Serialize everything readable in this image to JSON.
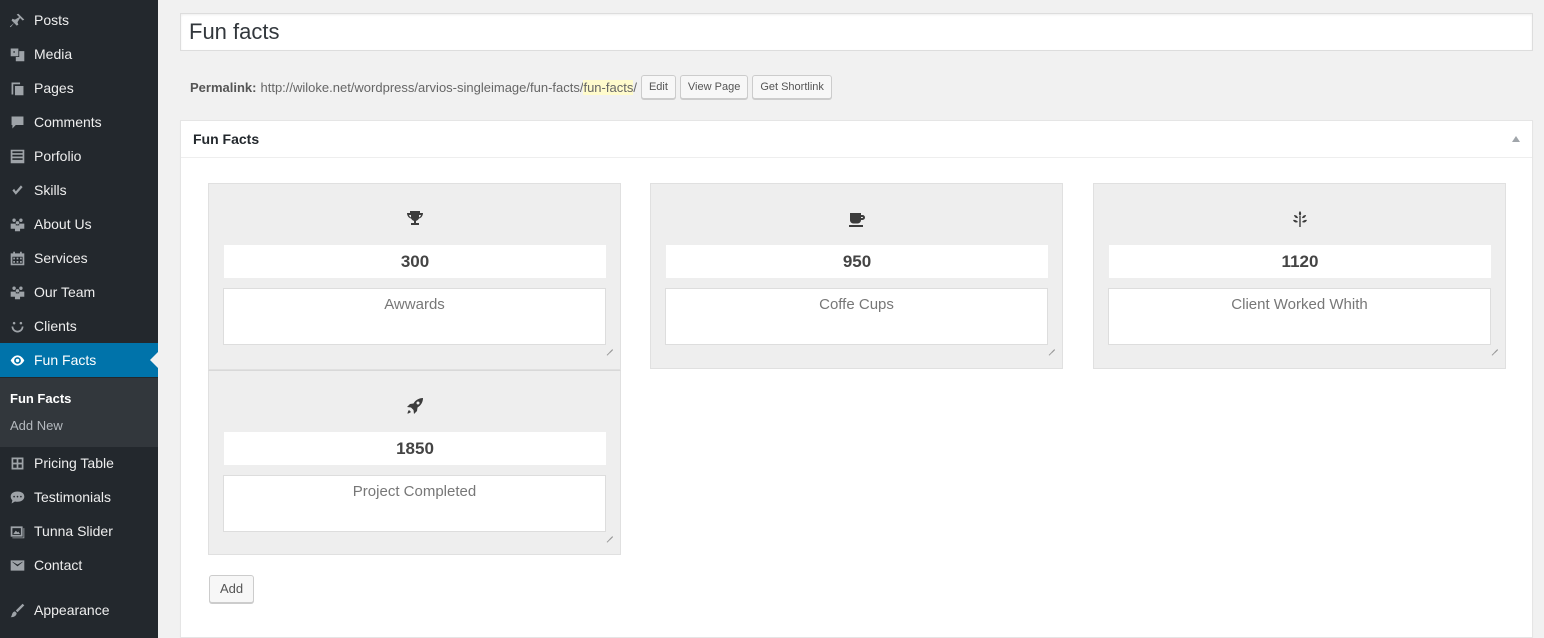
{
  "sidebar": {
    "items": [
      {
        "label": "Posts",
        "icon": "pin-icon"
      },
      {
        "label": "Media",
        "icon": "media-icon"
      },
      {
        "label": "Pages",
        "icon": "pages-icon"
      },
      {
        "label": "Comments",
        "icon": "comment-icon"
      },
      {
        "label": "Porfolio",
        "icon": "list-icon"
      },
      {
        "label": "Skills",
        "icon": "check-icon"
      },
      {
        "label": "About Us",
        "icon": "groups-icon"
      },
      {
        "label": "Services",
        "icon": "calendar-icon"
      },
      {
        "label": "Our Team",
        "icon": "groups-icon"
      },
      {
        "label": "Clients",
        "icon": "smiley-icon"
      },
      {
        "label": "Fun Facts",
        "icon": "visibility-icon",
        "active": true
      },
      {
        "label": "Pricing Table",
        "icon": "table-icon"
      },
      {
        "label": "Testimonials",
        "icon": "chat-icon"
      },
      {
        "label": "Tunna Slider",
        "icon": "slides-icon"
      },
      {
        "label": "Contact",
        "icon": "email-icon"
      },
      {
        "label": "Appearance",
        "icon": "brush-icon"
      }
    ],
    "submenu": [
      {
        "label": "Fun Facts",
        "current": true
      },
      {
        "label": "Add New"
      }
    ]
  },
  "editor": {
    "title_value": "Fun facts",
    "permalink_label": "Permalink:",
    "permalink_base": "http://wiloke.net/wordpress/arvios-singleimage/fun-facts/",
    "permalink_slug": "fun-facts",
    "permalink_trailing": "/",
    "edit_btn": "Edit",
    "view_btn": "View Page",
    "shortlink_btn": "Get Shortlink"
  },
  "metabox": {
    "title": "Fun Facts",
    "facts": [
      {
        "icon": "trophy-icon",
        "number": "300",
        "label": "Awwards"
      },
      {
        "icon": "coffee-icon",
        "number": "950",
        "label": "Coffe Cups"
      },
      {
        "icon": "leaf-icon",
        "number": "1120",
        "label": "Client Worked Whith"
      },
      {
        "icon": "rocket-icon",
        "number": "1850",
        "label": "Project Completed"
      }
    ],
    "add_btn": "Add"
  },
  "colors": {
    "sidebar_bg": "#23282d",
    "accent": "#0073aa",
    "submenu_bg": "#32373c",
    "card_bg": "#eeeeee"
  }
}
